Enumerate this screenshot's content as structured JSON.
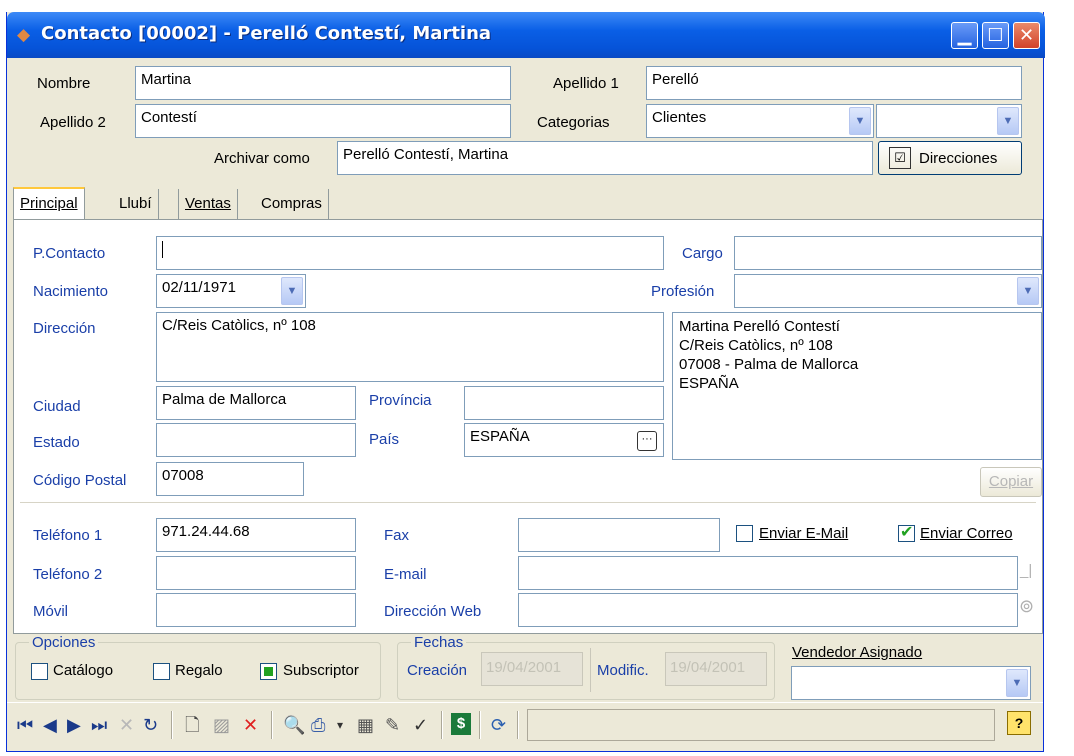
{
  "window": {
    "title": "Contacto [00002] - Perelló Contestí, Martina"
  },
  "header": {
    "nombre_label": "Nombre",
    "nombre_value": "Martina",
    "apellido1_label": "Apellido 1",
    "apellido1_value": "Perelló",
    "apellido2_label": "Apellido 2",
    "apellido2_value": "Contestí",
    "categorias_label": "Categorias",
    "categoria1_value": "Clientes",
    "categoria2_value": "",
    "archivar_label": "Archivar como",
    "archivar_value": "Perelló Contestí, Martina",
    "direcciones_button": "Direcciones"
  },
  "tabs": [
    {
      "label": "Principal",
      "active": true
    },
    {
      "label": "Llubí",
      "active": false
    },
    {
      "label": "Ventas",
      "active": false
    },
    {
      "label": "Compras",
      "active": false
    }
  ],
  "principal": {
    "pcontacto_label": "P.Contacto",
    "pcontacto_value": "",
    "cargo_label": "Cargo",
    "cargo_value": "",
    "nacimiento_label": "Nacimiento",
    "nacimiento_value": "02/11/1971",
    "profesion_label": "Profesión",
    "profesion_value": "",
    "direccion_label": "Dirección",
    "direccion_value": "C/Reis Catòlics, nº 108",
    "ciudad_label": "Ciudad",
    "ciudad_value": "Palma de Mallorca",
    "provincia_label": "Província",
    "provincia_value": "",
    "estado_label": "Estado",
    "estado_value": "",
    "pais_label": "País",
    "pais_value": "ESPAÑA",
    "codigo_label": "Código Postal",
    "codigo_value": "07008",
    "address_preview": [
      "Martina Perelló Contestí",
      "C/Reis Catòlics, nº 108",
      "07008 - Palma de Mallorca",
      "ESPAÑA"
    ],
    "copiar_button": "Copiar",
    "telefono1_label": "Teléfono 1",
    "telefono1_value": "971.24.44.68",
    "telefono2_label": "Teléfono 2",
    "telefono2_value": "",
    "movil_label": "Móvil",
    "movil_value": "",
    "fax_label": "Fax",
    "fax_value": "",
    "email_label": "E-mail",
    "email_value": "",
    "web_label": "Dirección Web",
    "web_value": "",
    "enviar_email_label": "Enviar E-Mail",
    "enviar_email_checked": false,
    "enviar_correo_label": "Enviar Correo",
    "enviar_correo_checked": true
  },
  "opciones": {
    "title": "Opciones",
    "catalogo_label": "Catálogo",
    "catalogo_checked": false,
    "regalo_label": "Regalo",
    "regalo_checked": false,
    "subscriptor_label": "Subscriptor",
    "subscriptor_checked": true
  },
  "fechas": {
    "title": "Fechas",
    "creacion_label": "Creación",
    "creacion_value": "19/04/2001",
    "modific_label": "Modific.",
    "modific_value": "19/04/2001"
  },
  "vendedor": {
    "label": "Vendedor Asignado",
    "value": ""
  },
  "colors": {
    "titlebar": "#0a5fe6",
    "label_blue": "#1a3fa8",
    "accent_check": "#21a121",
    "delete_red": "#e02020"
  },
  "toolbar": {
    "icons": [
      "first-record-icon",
      "previous-record-icon",
      "next-record-icon",
      "last-record-icon",
      "cancel-icon",
      "refresh-icon",
      "new-document-icon",
      "save-icon",
      "delete-icon",
      "search-icon",
      "print-icon",
      "print-dropdown-icon",
      "binoculars-icon",
      "notes-icon",
      "user-check-icon",
      "money-icon",
      "sync-icon",
      "help-icon"
    ]
  }
}
